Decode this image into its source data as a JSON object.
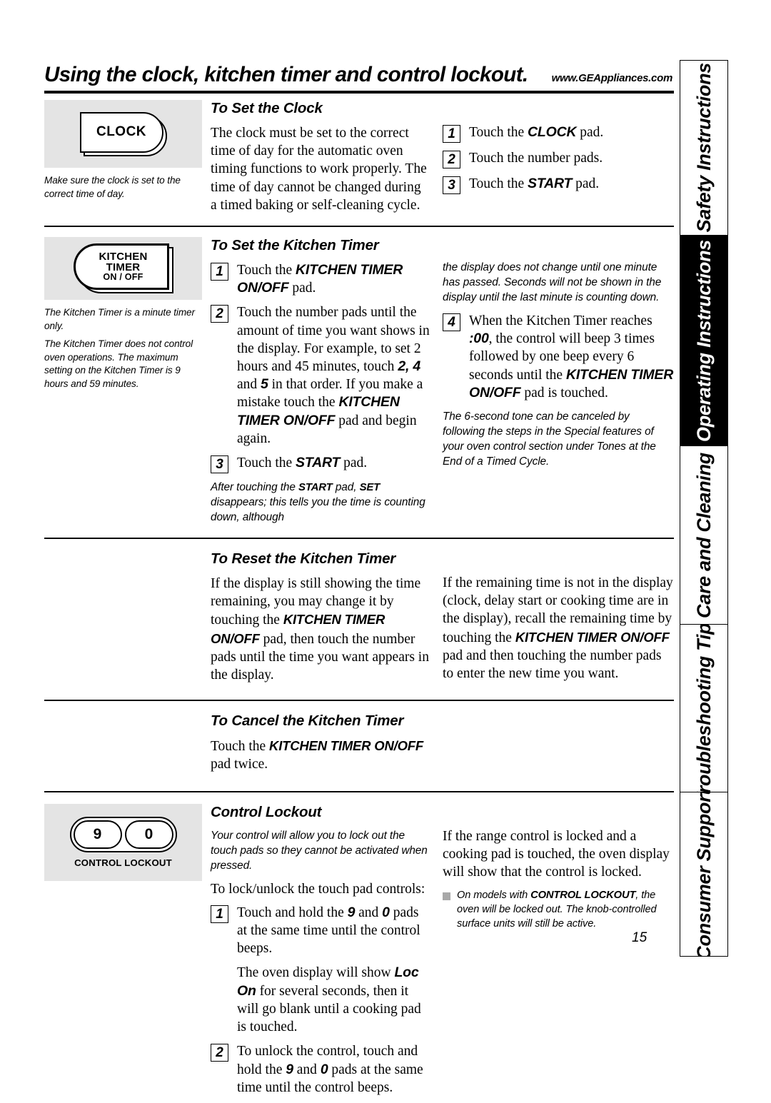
{
  "header": {
    "title": "Using the clock, kitchen timer and control lockout.",
    "url": "www.GEAppliances.com"
  },
  "tabs": [
    {
      "label": "Safety Instructions",
      "active": false
    },
    {
      "label": "Operating Instructions",
      "active": true
    },
    {
      "label": "Care and Cleaning",
      "active": false
    },
    {
      "label": "Troubleshooting Tips",
      "active": false
    },
    {
      "label": "Consumer Support",
      "active": false
    }
  ],
  "graphics": {
    "clock_pad": {
      "label": "CLOCK"
    },
    "kitchen_timer_pad": {
      "line1": "KITCHEN",
      "line2": "TIMER",
      "line3": "ON / OFF"
    },
    "lockout_pad": {
      "key_left": "9",
      "key_right": "0",
      "caption": "CONTROL LOCKOUT"
    }
  },
  "sections": {
    "clock": {
      "heading": "To Set the Clock",
      "side_note": "Make sure the clock is set to the correct time of day.",
      "body": "The clock must be set to the correct time of day for the automatic oven timing functions to work properly. The time of day cannot be changed during a timed baking or self-cleaning cycle.",
      "steps": [
        {
          "num": "1",
          "prefix": "Touch the ",
          "pad": "CLOCK",
          "suffix": " pad."
        },
        {
          "num": "2",
          "prefix": "Touch the number pads.",
          "pad": "",
          "suffix": ""
        },
        {
          "num": "3",
          "prefix": "Touch the ",
          "pad": "START",
          "suffix": " pad."
        }
      ]
    },
    "set_timer": {
      "heading": "To Set the Kitchen Timer",
      "side_note_1": "The Kitchen Timer is a minute timer only.",
      "side_note_2": "The Kitchen Timer does not control oven operations. The maximum setting on the Kitchen Timer is 9 hours and 59 minutes.",
      "step1": {
        "num": "1",
        "t1": "Touch the ",
        "b1": "KITCHEN TIMER ON/OFF",
        "t2": " pad."
      },
      "step2": {
        "num": "2",
        "t1": "Touch the number pads until the amount of time you want shows in the display. For example, to set 2 hours and 45 minutes, touch ",
        "b1": "2, 4",
        "t2": " and ",
        "b2": "5",
        "t3": " in that order. If you make a mistake touch the ",
        "b3": "KITCHEN TIMER ON/OFF",
        "t4": " pad and begin again."
      },
      "step3": {
        "num": "3",
        "t1": "Touch the ",
        "b1": "START",
        "t2": " pad."
      },
      "note_left": {
        "t1": "After touching the ",
        "b1": "START",
        "t2": " pad, ",
        "b2": "SET",
        "t3": " disappears; this tells you the time is counting down, although"
      },
      "note_right": "the display does not change until one minute has passed. Seconds will not be shown in the display until the last minute is counting down.",
      "step4": {
        "num": "4",
        "t1": "When the Kitchen Timer reaches ",
        "b1": ":00",
        "t2": ", the control will beep 3 times followed by one beep every 6 seconds until the ",
        "b2": "KITCHEN TIMER ON/OFF",
        "t3": " pad is touched."
      },
      "note_tone": "The 6-second tone can be canceled by following the steps in the Special features of your oven control section under Tones at the End of a Timed Cycle."
    },
    "reset_timer": {
      "heading": "To Reset the Kitchen Timer",
      "left": {
        "t1": "If the display is still showing the time remaining, you may change it by touching the ",
        "b1": "KITCHEN TIMER ON/OFF",
        "t2": " pad, then touch the number pads until the time you want appears in the display."
      },
      "right": {
        "t1": "If the remaining time is not in the display (clock, delay start or cooking time are in the display), recall the remaining time by touching the ",
        "b1": "KITCHEN TIMER ON/OFF",
        "t2": " pad and then touching the number pads to enter the new time you want."
      }
    },
    "cancel_timer": {
      "heading": "To Cancel the Kitchen Timer",
      "t1": "Touch the ",
      "b1": "KITCHEN TIMER ON/OFF",
      "t2": " pad twice."
    },
    "lockout": {
      "heading": "Control Lockout",
      "intro_note": "Your control will allow you to lock out the touch pads so they cannot be activated when pressed.",
      "lead": "To lock/unlock the touch pad controls:",
      "step1": {
        "num": "1",
        "t1": "Touch and hold the ",
        "b1": "9",
        "t2": " and ",
        "b2": "0",
        "t3": " pads at the same time until the control beeps."
      },
      "step1_cont": {
        "t1": "The oven display will show ",
        "b1": "Loc On",
        "t2": " for several seconds, then it will go blank until a cooking pad is touched."
      },
      "step2": {
        "num": "2",
        "t1": "To unlock the control, touch and hold the ",
        "b1": "9",
        "t2": " and ",
        "b2": "0",
        "t3": " pads at the same time until the control beeps."
      },
      "right_body": "If the range control is locked and a cooking pad is touched, the oven display will show that the control is locked.",
      "bullet": {
        "t1": "On models with ",
        "b1": "CONTROL LOCKOUT",
        "t2": ", the oven will be locked out. The knob-controlled surface units will still be active."
      }
    }
  },
  "page_number": "15"
}
